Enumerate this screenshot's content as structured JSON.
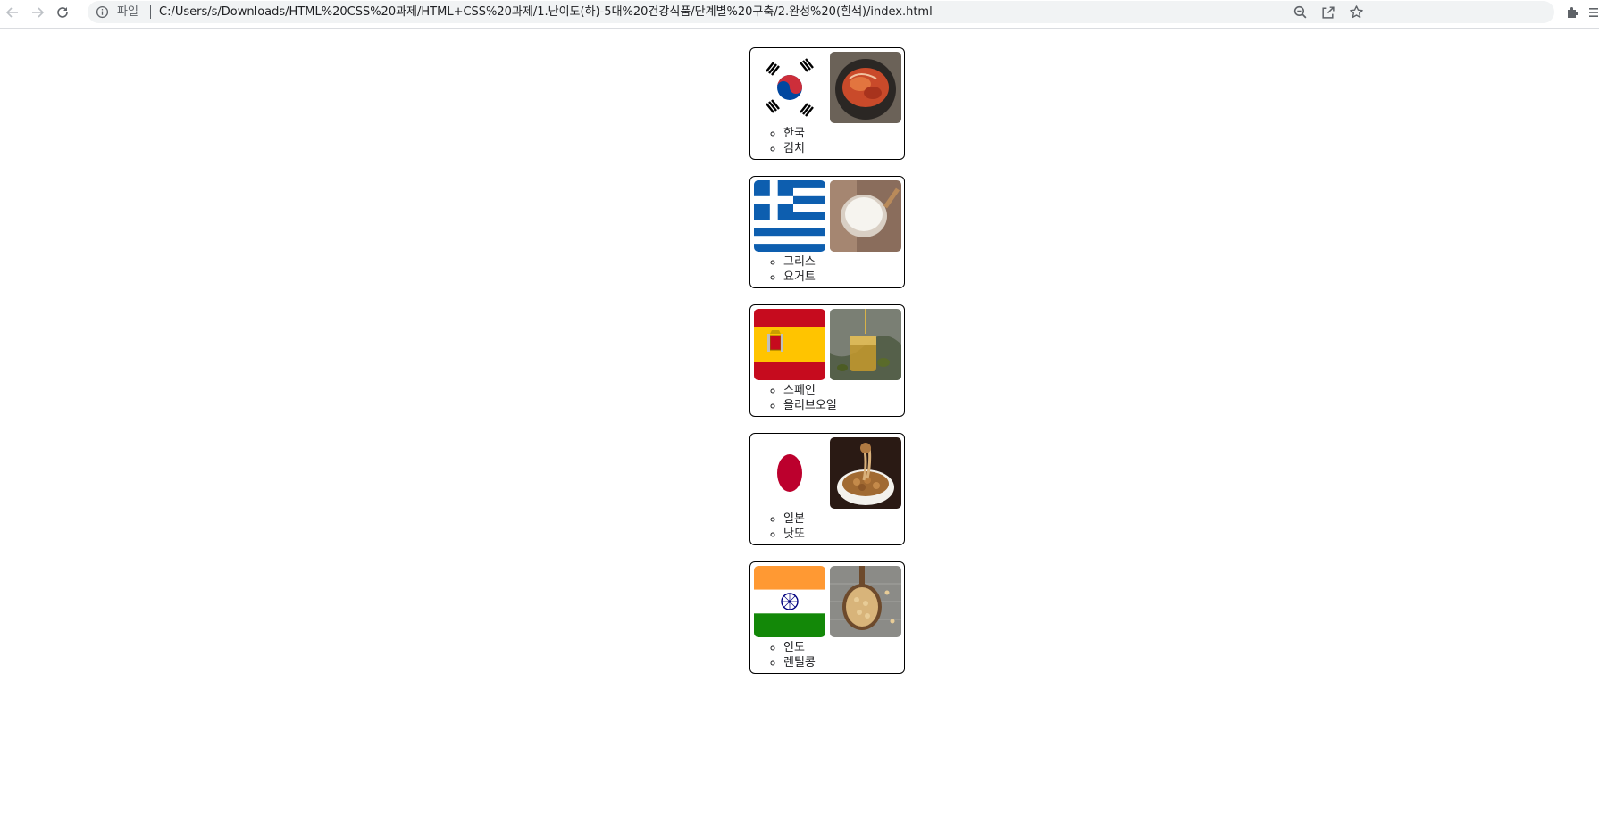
{
  "browser": {
    "scheme_label": "파일",
    "url": "C:/Users/s/Downloads/HTML%20CSS%20과제/HTML+CSS%20과제/1.난이도(하)-5대%20건강식품/단계별%20구축/2.완성%20(흰색)/index.html",
    "icons": [
      "back-icon",
      "forward-icon",
      "reload-icon",
      "info-icon",
      "zoom-icon",
      "share-icon",
      "star-icon",
      "extensions-icon",
      "menu-icon"
    ]
  },
  "foods": [
    {
      "country": "한국",
      "food": "김치",
      "flag_icon": "korea-flag",
      "food_icon": "kimchi-photo"
    },
    {
      "country": "그리스",
      "food": "요거트",
      "flag_icon": "greece-flag",
      "food_icon": "yogurt-photo"
    },
    {
      "country": "스페인",
      "food": "올리브오일",
      "flag_icon": "spain-flag",
      "food_icon": "olive-oil-photo"
    },
    {
      "country": "일본",
      "food": "낫또",
      "flag_icon": "japan-flag",
      "food_icon": "natto-photo"
    },
    {
      "country": "인도",
      "food": "렌틸콩",
      "flag_icon": "india-flag",
      "food_icon": "lentil-photo"
    }
  ],
  "colors": {
    "korea_red": "#cd2e3a",
    "korea_blue": "#0047a0",
    "greece_blue": "#0d5eaf",
    "spain_red": "#c60b1e",
    "spain_yellow": "#ffc400",
    "japan_red": "#bc002d",
    "india_saffron": "#ff9933",
    "india_green": "#138808",
    "india_chakra": "#000080"
  }
}
